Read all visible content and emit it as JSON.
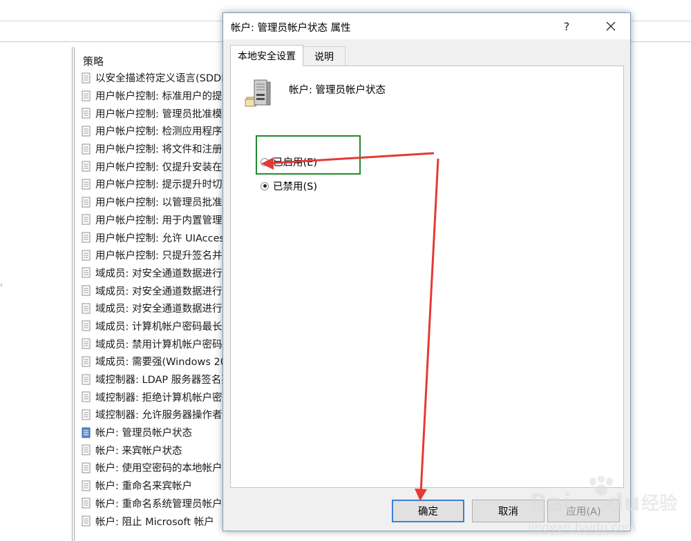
{
  "policy_pane": {
    "column_header": "策略",
    "items": [
      {
        "label": "以安全描述符定义语言(SDDL"
      },
      {
        "label": "用户帐户控制: 标准用户的提"
      },
      {
        "label": "用户帐户控制: 管理员批准模"
      },
      {
        "label": "用户帐户控制: 检测应用程序"
      },
      {
        "label": "用户帐户控制: 将文件和注册"
      },
      {
        "label": "用户帐户控制: 仅提升安装在"
      },
      {
        "label": "用户帐户控制: 提示提升时切"
      },
      {
        "label": "用户帐户控制: 以管理员批准"
      },
      {
        "label": "用户帐户控制: 用于内置管理"
      },
      {
        "label": "用户帐户控制: 允许 UIAcces"
      },
      {
        "label": "用户帐户控制: 只提升签名并"
      },
      {
        "label": "域成员: 对安全通道数据进行"
      },
      {
        "label": "域成员: 对安全通道数据进行"
      },
      {
        "label": "域成员: 对安全通道数据进行"
      },
      {
        "label": "域成员: 计算机帐户密码最长"
      },
      {
        "label": "域成员: 禁用计算机帐户密码"
      },
      {
        "label": "域成员: 需要强(Windows 20"
      },
      {
        "label": "域控制器: LDAP 服务器签名要"
      },
      {
        "label": "域控制器: 拒绝计算机帐户密"
      },
      {
        "label": "域控制器: 允许服务器操作者"
      },
      {
        "label": "帐户: 管理员帐户状态",
        "selected": true
      },
      {
        "label": "帐户: 来宾帐户状态"
      },
      {
        "label": "帐户: 使用空密码的本地帐户"
      },
      {
        "label": "帐户: 重命名来宾帐户"
      },
      {
        "label": "帐户: 重命名系统管理员帐户"
      },
      {
        "label": "帐户: 阻止 Microsoft 帐户"
      }
    ]
  },
  "dialog": {
    "title": "帐户: 管理员帐户状态 属性",
    "help_label": "?",
    "tabs": [
      {
        "label": "本地安全设置",
        "active": true
      },
      {
        "label": "说明",
        "active": false
      }
    ],
    "policy_name": "帐户: 管理员帐户状态",
    "options": [
      {
        "label": "已启用(E)",
        "checked": false
      },
      {
        "label": "已禁用(S)",
        "checked": true
      }
    ],
    "buttons": {
      "ok": "确定",
      "cancel": "取消",
      "apply": "应用(A)"
    }
  },
  "annotation": {
    "arrow_color": "#e53935",
    "box_color": "#1f8a2b"
  },
  "watermark": {
    "brand": "Bai du 经验",
    "url": "jingyan.baidu.com"
  }
}
